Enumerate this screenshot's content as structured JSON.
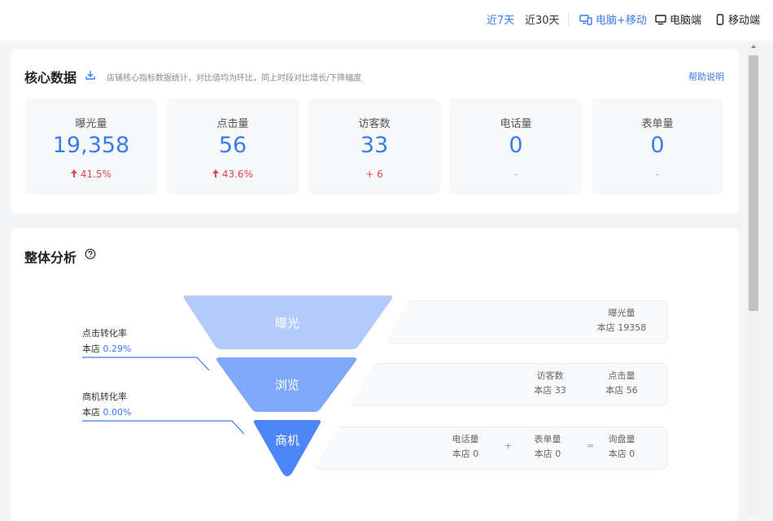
{
  "topbar": {
    "ranges": [
      "近7天",
      "近30天"
    ],
    "devices": [
      {
        "label": "电脑+移动",
        "icon": "desktop-mobile-icon"
      },
      {
        "label": "电脑端",
        "icon": "desktop-icon"
      },
      {
        "label": "移动端",
        "icon": "mobile-icon"
      }
    ]
  },
  "core": {
    "title": "核心数据",
    "description": "店铺核心指标数据统计，对比值均为环比，同上时段对比增长/下降幅度",
    "help": "帮助说明",
    "metrics": [
      {
        "label": "曝光量",
        "value": "19,358",
        "change": "41.5%"
      },
      {
        "label": "点击量",
        "value": "56",
        "change": "43.6%"
      },
      {
        "label": "访客数",
        "value": "33",
        "change": "+ 6"
      },
      {
        "label": "电话量",
        "value": "0",
        "change": "-"
      },
      {
        "label": "表单量",
        "value": "0",
        "change": "-"
      }
    ]
  },
  "analysis": {
    "title": "整体分析",
    "funnel": [
      "曝光",
      "浏览",
      "商机"
    ],
    "conversions": [
      {
        "label": "点击转化率",
        "prefix": "本店",
        "value": "0.29%"
      },
      {
        "label": "商机转化率",
        "prefix": "本店",
        "value": "0.00%"
      }
    ],
    "rows": [
      {
        "items": [
          {
            "label": "曝光量",
            "value": "本店 19358"
          }
        ]
      },
      {
        "items": [
          {
            "label": "访客数",
            "value": "本店 33"
          },
          {
            "label": "点击量",
            "value": "本店 56"
          }
        ]
      },
      {
        "items": [
          {
            "label": "电话量",
            "value": "本店 0"
          },
          {
            "label": "表单量",
            "value": "本店 0"
          },
          {
            "label": "询盘量",
            "value": "本店 0"
          }
        ],
        "ops": [
          "+",
          "="
        ]
      }
    ]
  },
  "colors": {
    "accent": "#3a7bf0",
    "up": "#e8464f",
    "funnel_1": "#b3cbfb",
    "funnel_2": "#7fa8f8",
    "funnel_3": "#4c86f6"
  }
}
